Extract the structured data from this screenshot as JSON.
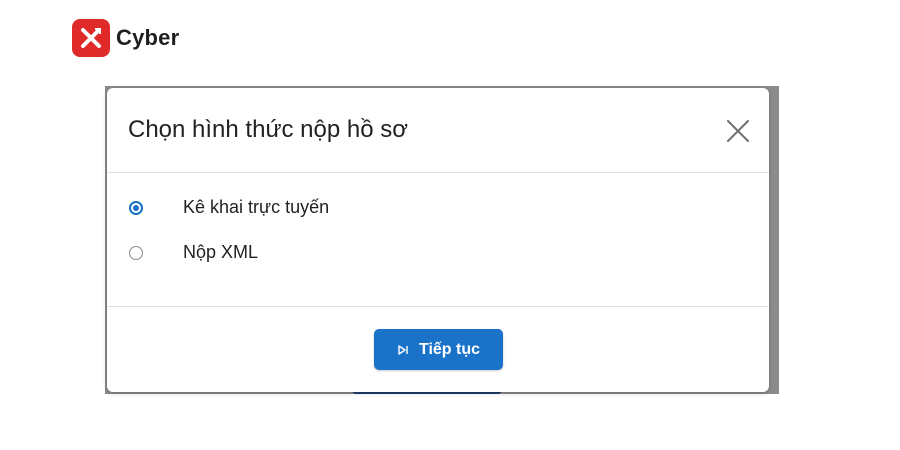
{
  "brand": {
    "name": "Cyber",
    "logo_color": "#e02a2a"
  },
  "modal": {
    "title": "Chọn hình thức nộp hồ sơ",
    "close_icon": "close-icon",
    "options": [
      {
        "label": "Kê khai trực tuyến",
        "checked": true
      },
      {
        "label": "Nộp XML",
        "checked": false
      }
    ],
    "primary_button": {
      "label": "Tiếp tục",
      "icon": "skip-forward-icon",
      "color": "#1a73c9"
    }
  }
}
